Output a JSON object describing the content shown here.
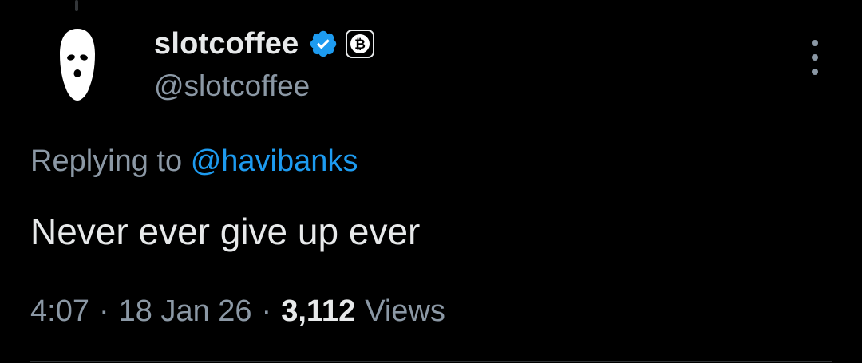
{
  "author": {
    "display_name": "slotcoffee",
    "handle": "@slotcoffee",
    "avatar_icon": "ski-mask-icon",
    "verified_icon": "verified-badge-icon",
    "affiliate_icon": "bitcoin-icon"
  },
  "reply": {
    "prefix": "Replying to",
    "mention": "@havibanks"
  },
  "tweet": {
    "text": "Never ever give up ever"
  },
  "meta": {
    "time": "4:07",
    "separator": "·",
    "date": "18 Jan 26",
    "views_count": "3,112",
    "views_label": "Views"
  },
  "more_icon": "more-options-icon",
  "colors": {
    "background": "#000000",
    "primary_text": "#e7e9ea",
    "secondary_text": "#8b98a5",
    "accent": "#1d9bf0"
  }
}
